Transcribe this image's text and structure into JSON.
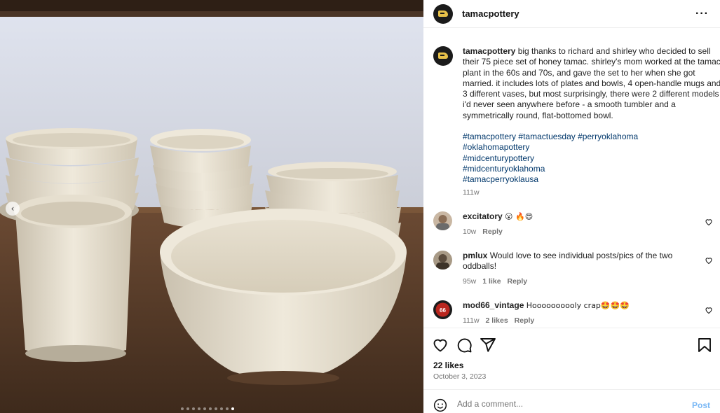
{
  "post": {
    "username": "tamacpottery",
    "caption_user": "tamacpottery",
    "caption": "big thanks to richard and shirley who decided to sell their 75 piece set of honey tamac. shirley's mom worked at the tamac plant in the 60s and 70s, and gave the set to her when she got married. it includes lots of plates and bowls, 4 open-handle mugs and 3 different vases, but most surprisingly, there were 2 different models i'd never seen anywhere before - a smooth tumbler and a symmetrically round, flat-bottomed bowl.",
    "hashtags": [
      "#tamacpottery",
      "#tamactuesday",
      "#perryoklahoma",
      "#oklahomapottery",
      "#midcenturypottery",
      "#midcenturyoklahoma",
      "#tamacperryoklausa"
    ],
    "caption_time": "111w",
    "likes": "22 likes",
    "date": "October 3, 2023"
  },
  "comments": [
    {
      "user": "excitatory",
      "text": "😮 🔥😍",
      "time": "10w",
      "reply": "Reply",
      "likes": ""
    },
    {
      "user": "pmlux",
      "text": "Would love to see individual posts/pics of the two oddballs!",
      "time": "95w",
      "likes": "1 like",
      "reply": "Reply"
    },
    {
      "user": "mod66_vintage",
      "text": "Hoooooooooly crap🤩🤩🤩",
      "time": "111w",
      "likes": "2 likes",
      "reply": "Reply"
    }
  ],
  "composer": {
    "placeholder": "Add a comment...",
    "post_label": "Post"
  },
  "icons": {
    "more": "more-options-icon",
    "like": "heart-icon",
    "comment": "comment-icon",
    "share": "share-icon",
    "save": "bookmark-icon",
    "emoji": "emoji-icon",
    "prev": "chevron-left-icon"
  },
  "carousel": {
    "total": 10,
    "active": 10
  },
  "colors": {
    "link": "#00376b",
    "muted": "#737373",
    "post_button": "#7ab8f5"
  }
}
